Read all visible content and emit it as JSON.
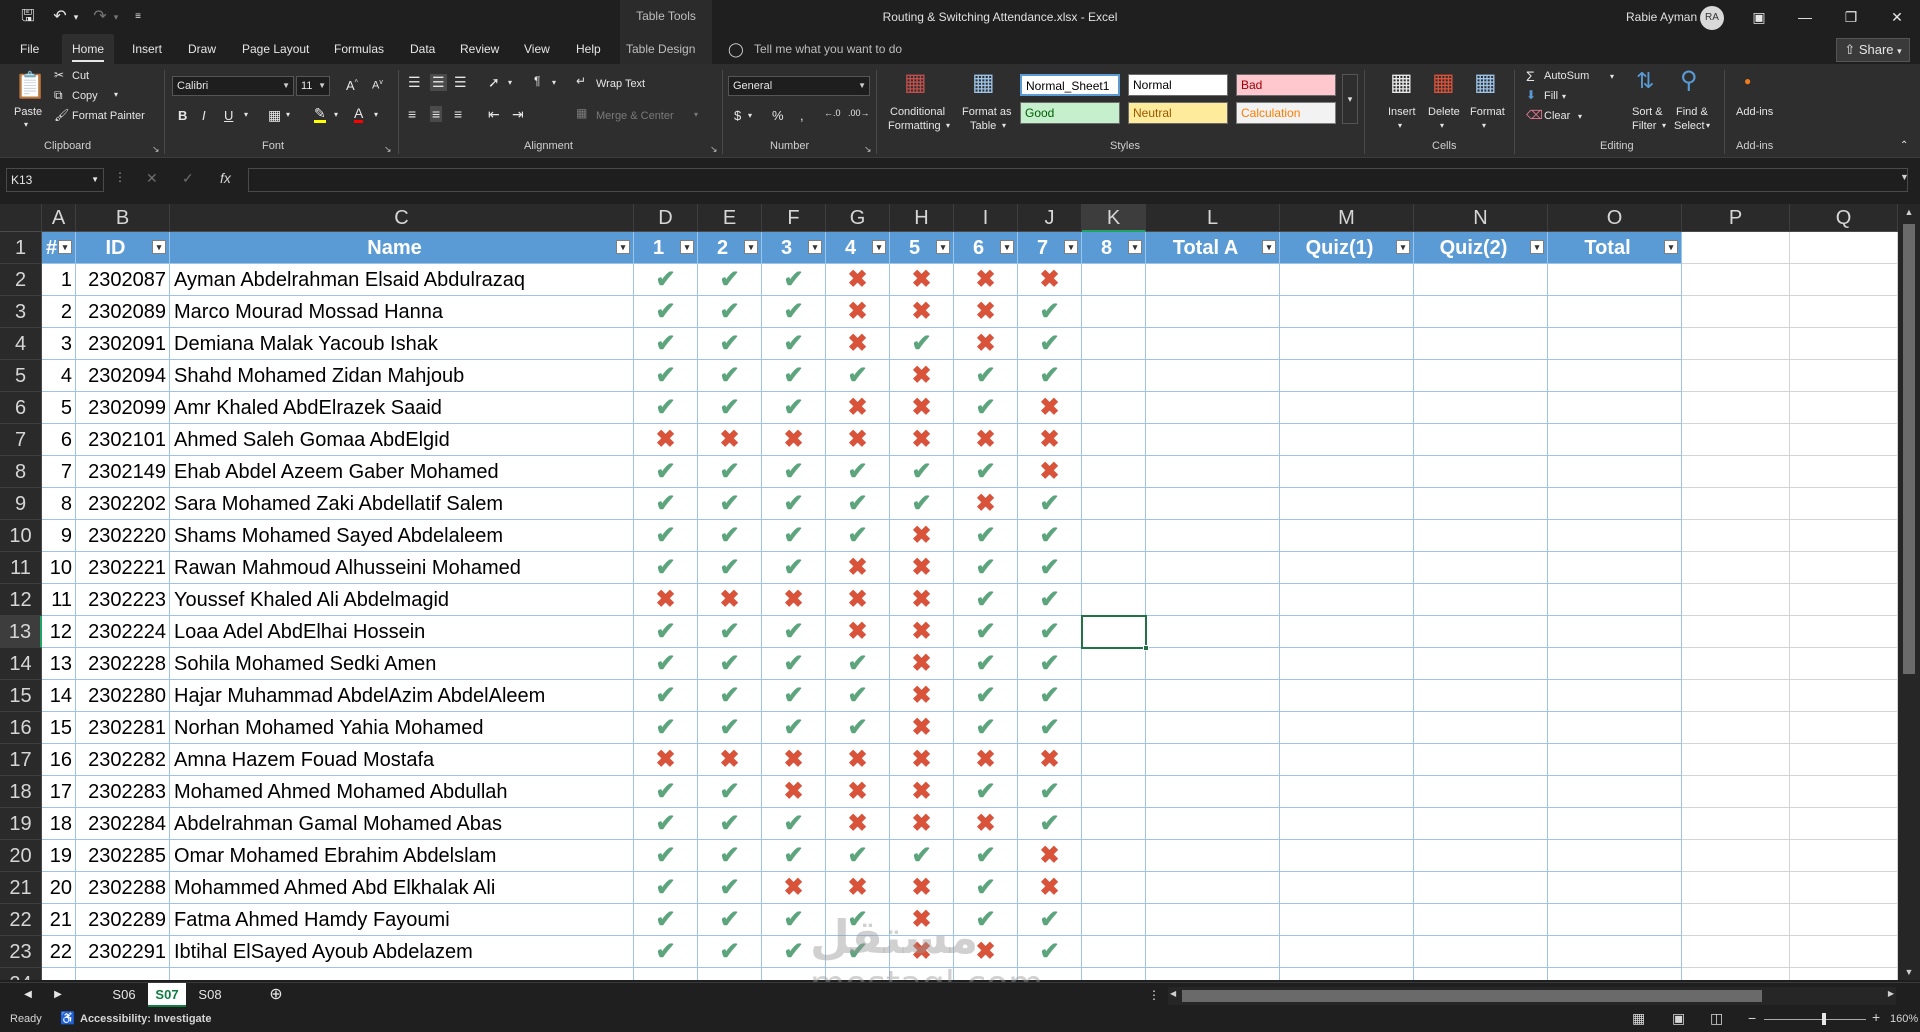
{
  "titlebar": {
    "table_tools": "Table Tools",
    "document_title": "Routing & Switching Attendance.xlsx  -  Excel",
    "user_name": "Rabie Ayman",
    "user_initials": "RA"
  },
  "tabs": [
    "File",
    "Home",
    "Insert",
    "Draw",
    "Page Layout",
    "Formulas",
    "Data",
    "Review",
    "View",
    "Help",
    "Table Design"
  ],
  "tellme_placeholder": "Tell me what you want to do",
  "share_label": "Share",
  "ribbon": {
    "clipboard": {
      "paste": "Paste",
      "cut": "Cut",
      "copy": "Copy",
      "format_painter": "Format Painter",
      "label": "Clipboard"
    },
    "font": {
      "name": "Calibri",
      "size": "11",
      "label": "Font"
    },
    "alignment": {
      "wrap_text": "Wrap Text",
      "merge_center": "Merge & Center",
      "label": "Alignment"
    },
    "number": {
      "format": "General",
      "label": "Number"
    },
    "styles": {
      "conditional": "Conditional",
      "conditional2": "Formatting",
      "format_as": "Format as",
      "format_as2": "Table",
      "normal_sheet1": "Normal_Sheet1",
      "normal": "Normal",
      "bad": "Bad",
      "good": "Good",
      "neutral": "Neutral",
      "calculation": "Calculation",
      "label": "Styles"
    },
    "cells": {
      "insert": "Insert",
      "delete": "Delete",
      "format": "Format",
      "label": "Cells"
    },
    "editing": {
      "autosum": "AutoSum",
      "fill": "Fill",
      "clear": "Clear",
      "sort": "Sort &",
      "sort2": "Filter",
      "find": "Find &",
      "find2": "Select",
      "label": "Editing"
    },
    "addins": {
      "addins": "Add-ins",
      "label": "Add-ins"
    }
  },
  "formula_bar": {
    "name_box": "K13",
    "fx": "fx",
    "content": ""
  },
  "columns": [
    "A",
    "B",
    "C",
    "D",
    "E",
    "F",
    "G",
    "H",
    "I",
    "J",
    "K",
    "L",
    "M",
    "N",
    "O",
    "P",
    "Q"
  ],
  "table_headers": [
    "#",
    "ID",
    "Name",
    "1",
    "2",
    "3",
    "4",
    "5",
    "6",
    "7",
    "8",
    "Total A",
    "Quiz(1)",
    "Quiz(2)",
    "Total"
  ],
  "rows": [
    {
      "n": "1",
      "id": "2302087",
      "name": "Ayman Abdelrahman Elsaid Abdulrazaq",
      "att": "1110000"
    },
    {
      "n": "2",
      "id": "2302089",
      "name": "Marco Mourad Mossad Hanna",
      "att": "1110001"
    },
    {
      "n": "3",
      "id": "2302091",
      "name": "Demiana Malak Yacoub Ishak",
      "att": "1110101"
    },
    {
      "n": "4",
      "id": "2302094",
      "name": "Shahd Mohamed Zidan Mahjoub",
      "att": "1111011"
    },
    {
      "n": "5",
      "id": "2302099",
      "name": "Amr Khaled AbdElrazek Saaid",
      "att": "1110010"
    },
    {
      "n": "6",
      "id": "2302101",
      "name": "Ahmed Saleh Gomaa AbdElgid",
      "att": "0000000"
    },
    {
      "n": "7",
      "id": "2302149",
      "name": "Ehab Abdel Azeem Gaber Mohamed",
      "att": "1111110"
    },
    {
      "n": "8",
      "id": "2302202",
      "name": "Sara Mohamed Zaki Abdellatif Salem",
      "att": "1111101"
    },
    {
      "n": "9",
      "id": "2302220",
      "name": "Shams Mohamed Sayed Abdelaleem",
      "att": "1111011"
    },
    {
      "n": "10",
      "id": "2302221",
      "name": "Rawan Mahmoud Alhusseini Mohamed",
      "att": "1110011"
    },
    {
      "n": "11",
      "id": "2302223",
      "name": "Youssef Khaled Ali Abdelmagid",
      "att": "0000011"
    },
    {
      "n": "12",
      "id": "2302224",
      "name": "Loaa Adel AbdElhai Hossein",
      "att": "1110011"
    },
    {
      "n": "13",
      "id": "2302228",
      "name": "Sohila Mohamed Sedki Amen",
      "att": "1111011"
    },
    {
      "n": "14",
      "id": "2302280",
      "name": "Hajar Muhammad AbdelAzim AbdelAleem",
      "att": "1111011"
    },
    {
      "n": "15",
      "id": "2302281",
      "name": "Norhan Mohamed Yahia Mohamed",
      "att": "1111011"
    },
    {
      "n": "16",
      "id": "2302282",
      "name": "Amna Hazem Fouad Mostafa",
      "att": "0000000"
    },
    {
      "n": "17",
      "id": "2302283",
      "name": "Mohamed Ahmed Mohamed Abdullah",
      "att": "1100011"
    },
    {
      "n": "18",
      "id": "2302284",
      "name": "Abdelrahman Gamal Mohamed Abas",
      "att": "1110001"
    },
    {
      "n": "19",
      "id": "2302285",
      "name": "Omar Mohamed Ebrahim Abdelslam",
      "att": "1111110"
    },
    {
      "n": "20",
      "id": "2302288",
      "name": "Mohammed Ahmed Abd Elkhalak Ali",
      "att": "1100010"
    },
    {
      "n": "21",
      "id": "2302289",
      "name": "Fatma Ahmed Hamdy Fayoumi",
      "att": "1111011"
    },
    {
      "n": "22",
      "id": "2302291",
      "name": "Ibtihal ElSayed Ayoub Abdelazem",
      "att": "1111001"
    }
  ],
  "sheets": [
    "S06",
    "S07",
    "S08"
  ],
  "active_sheet": "S07",
  "status": {
    "ready": "Ready",
    "accessibility": "Accessibility: Investigate",
    "zoom": "160%"
  },
  "watermark": {
    "arabic": "مستقل",
    "latin": "mostaql.com"
  },
  "colors": {
    "check": "#5da57f",
    "cross": "#d9533b",
    "table_header": "#5b9bd5",
    "accent": "#217346"
  }
}
